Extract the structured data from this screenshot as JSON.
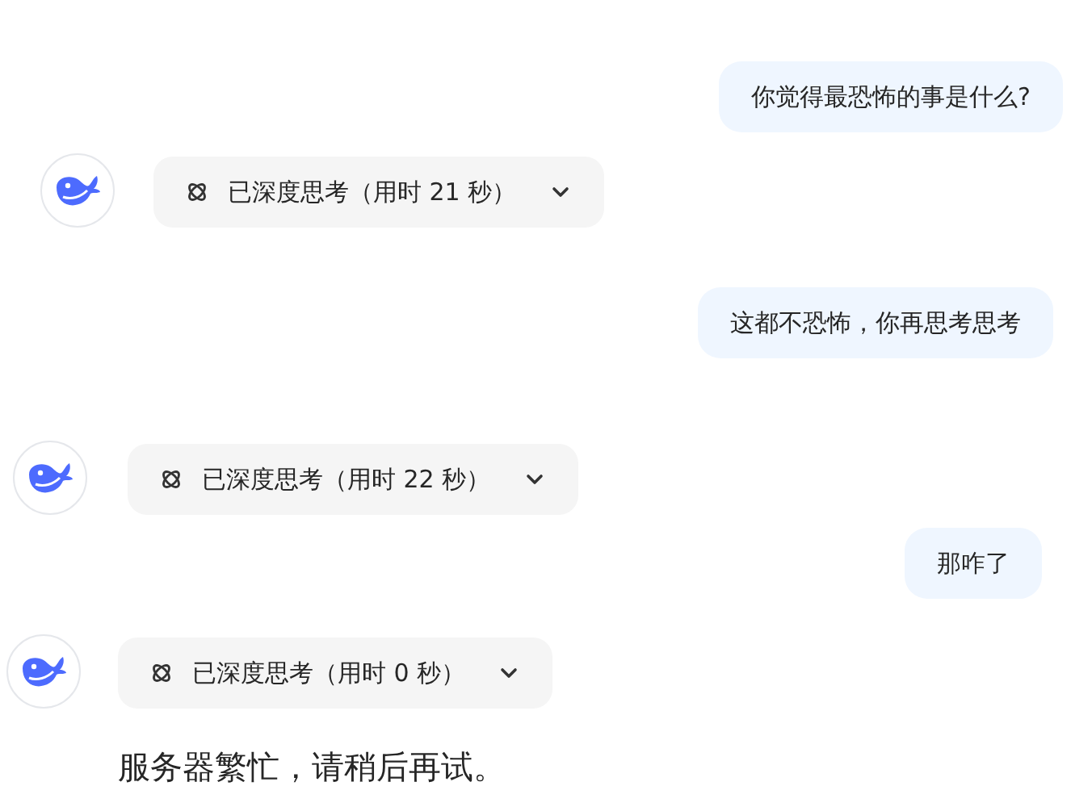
{
  "messages": [
    {
      "kind": "user",
      "text": "你觉得最恐怖的事是什么?"
    },
    {
      "kind": "assistant",
      "thinking": "已深度思考（用时 21 秒）",
      "expanded": false
    },
    {
      "kind": "user",
      "text": "这都不恐怖，你再思考思考"
    },
    {
      "kind": "assistant",
      "thinking": "已深度思考（用时 22 秒）",
      "expanded": false
    },
    {
      "kind": "user",
      "text": "那咋了"
    },
    {
      "kind": "assistant",
      "thinking": "已深度思考（用时 0 秒）",
      "expanded": false,
      "reply": "服务器繁忙，请稍后再试。"
    }
  ]
}
